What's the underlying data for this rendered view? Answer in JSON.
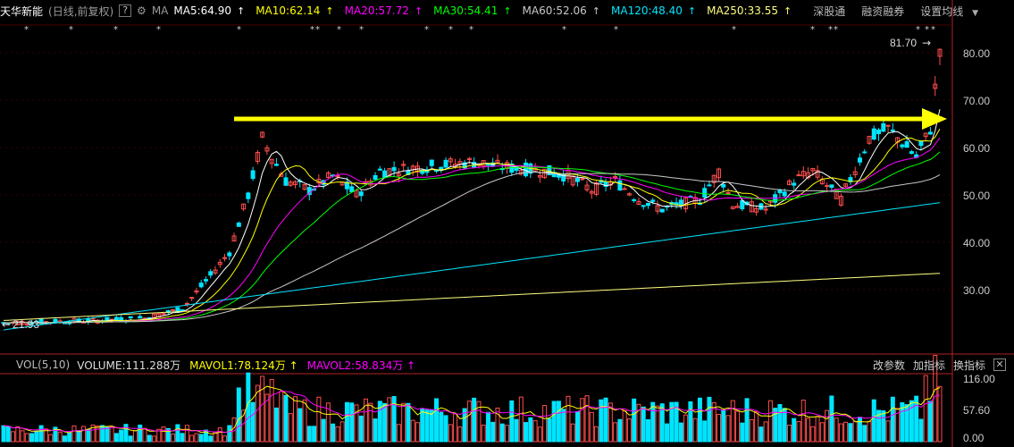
{
  "stock": {
    "name": "天华新能",
    "period": "(日线,前复权)",
    "help": "?"
  },
  "ma_label": "MA",
  "ma_items": [
    {
      "label": "MA5:64.90",
      "color": "#ffffff",
      "arrow": "↑"
    },
    {
      "label": "MA10:62.14",
      "color": "#ffff00",
      "arrow": "↑"
    },
    {
      "label": "MA20:57.72",
      "color": "#ff00ff",
      "arrow": "↑"
    },
    {
      "label": "MA30:54.41",
      "color": "#00ff00",
      "arrow": "↑"
    },
    {
      "label": "MA60:52.06",
      "color": "#c8c8c8",
      "arrow": "↑"
    },
    {
      "label": "MA120:48.40",
      "color": "#00e5ff",
      "arrow": "↑"
    },
    {
      "label": "MA250:33.55",
      "color": "#ffff7f",
      "arrow": "↑"
    }
  ],
  "toolbar": {
    "shenzhen": "深股通",
    "margin": "融资融券",
    "settings": "设置均线"
  },
  "price_axis": [
    "80.00",
    "70.00",
    "60.00",
    "50.00",
    "40.00",
    "30.00"
  ],
  "annotations": {
    "high_label": "81.70",
    "low_label": "21.93"
  },
  "volume": {
    "label": "VOL(5,10)",
    "main": "VOLUME:111.288万",
    "mavol1": "MAVOL1:78.124万",
    "mavol2": "MAVOL2:58.834万",
    "arrow": "↑",
    "axis": [
      "116.00",
      "57.60",
      "0.00"
    ],
    "actions": {
      "params": "改参数",
      "add": "加指标",
      "switch": "换指标",
      "close": "✕"
    }
  },
  "colors": {
    "up": "#ff4d4d",
    "down": "#00e5ff",
    "ma5": "#ffffff",
    "ma10": "#ffff00",
    "ma20": "#ff00ff",
    "ma30": "#00ff00",
    "ma60": "#c8c8c8",
    "ma120": "#00e5ff",
    "ma250": "#ffff7f",
    "trendline": "#ffff00"
  }
}
